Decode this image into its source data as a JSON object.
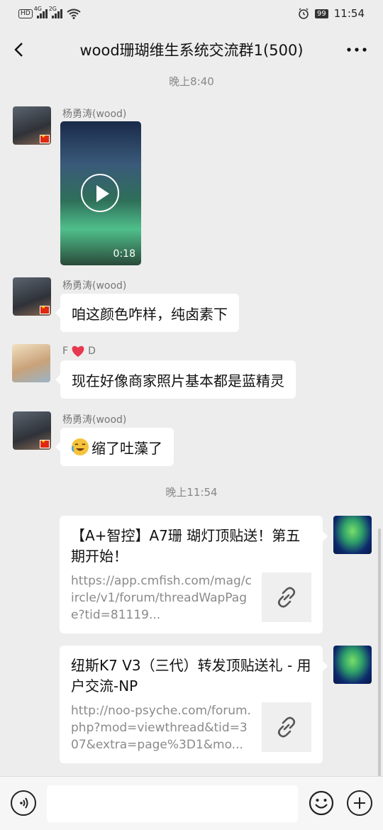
{
  "status_bar": {
    "network_1": "4G",
    "network_2": "2G",
    "battery": "99",
    "time": "11:54"
  },
  "header": {
    "title": "wood珊瑚维生系统交流群1(500)"
  },
  "messages": {
    "time_1": "晚上8:40",
    "video_msg": {
      "sender": "杨勇涛(wood)",
      "duration": "0:18"
    },
    "msg2": {
      "sender": "杨勇涛(wood)",
      "text": "咱这颜色咋样，纯卤素下"
    },
    "msg3": {
      "sender_left": "F",
      "sender_right": "D",
      "text": "现在好像商家照片基本都是蓝精灵"
    },
    "msg4": {
      "sender": "杨勇涛(wood)",
      "text": "缩了吐藻了"
    },
    "time_2": "晚上11:54",
    "card1": {
      "title": "【A+智控】A7珊 瑚灯顶贴送！第五期开始！",
      "url": "https://app.cmfish.com/mag/circle/v1/forum/threadWapPage?tid=81119..."
    },
    "card2": {
      "title": "纽斯K7 V3（三代）转发顶贴送礼 - 用户交流-NP",
      "url": "http://noo-psyche.com/forum.php?mod=viewthread&tid=307&extra=page%3D1&mo..."
    }
  },
  "colors": {
    "background": "#ededed",
    "bubble": "#ffffff",
    "heart": "#e8384f"
  }
}
